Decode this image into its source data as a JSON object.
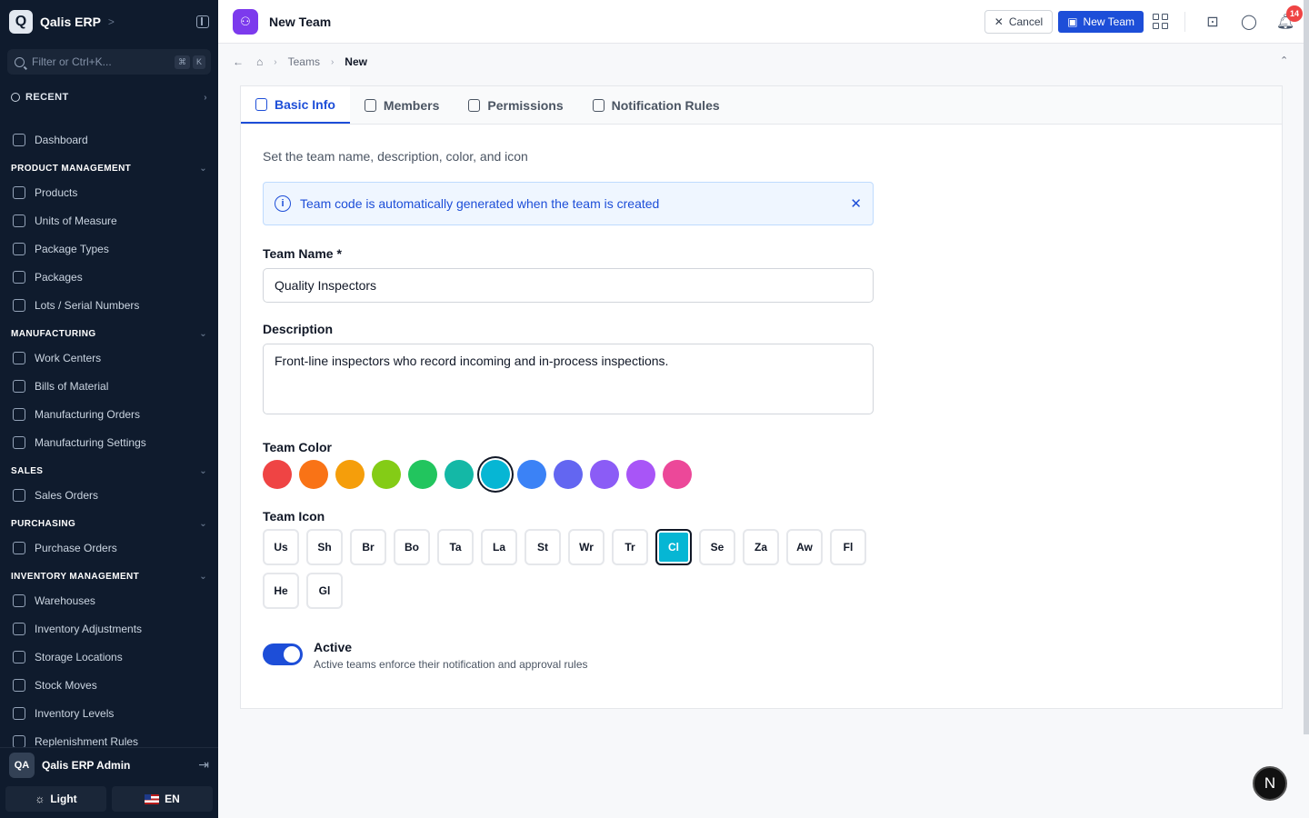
{
  "app": {
    "logo_letter": "Q",
    "name": "Qalis ERP"
  },
  "filter": {
    "placeholder": "Filter or Ctrl+K...",
    "keys": [
      "⌘",
      "K"
    ]
  },
  "recent": {
    "label": "RECENT"
  },
  "nav": {
    "dashboard": "Dashboard",
    "sections": [
      {
        "title": "PRODUCT MANAGEMENT",
        "items": [
          "Products",
          "Units of Measure",
          "Package Types",
          "Packages",
          "Lots / Serial Numbers"
        ]
      },
      {
        "title": "MANUFACTURING",
        "items": [
          "Work Centers",
          "Bills of Material",
          "Manufacturing Orders",
          "Manufacturing Settings"
        ]
      },
      {
        "title": "SALES",
        "items": [
          "Sales Orders"
        ]
      },
      {
        "title": "PURCHASING",
        "items": [
          "Purchase Orders"
        ]
      },
      {
        "title": "INVENTORY MANAGEMENT",
        "items": [
          "Warehouses",
          "Inventory Adjustments",
          "Storage Locations",
          "Stock Moves",
          "Inventory Levels",
          "Replenishment Rules"
        ]
      }
    ]
  },
  "user": {
    "initials": "QA",
    "name": "Qalis ERP Admin"
  },
  "footer": {
    "theme_label": "Light",
    "lang_label": "EN"
  },
  "topbar": {
    "title": "New Team",
    "cancel_label": "Cancel",
    "primary_label": "New Team",
    "notification_count": "14"
  },
  "breadcrumb": {
    "parent": "Teams",
    "current": "New"
  },
  "tabs": [
    {
      "label": "Basic Info",
      "icon": "document-icon",
      "active": true
    },
    {
      "label": "Members",
      "icon": "users-icon",
      "active": false
    },
    {
      "label": "Permissions",
      "icon": "shield-icon",
      "active": false
    },
    {
      "label": "Notification Rules",
      "icon": "bell-icon",
      "active": false
    }
  ],
  "form": {
    "description": "Set the team name, description, color, and icon",
    "alert": "Team code is automatically generated when the team is created",
    "name_label": "Team Name *",
    "name_value": "Quality Inspectors",
    "desc_label": "Description",
    "desc_value": "Front-line inspectors who record incoming and in-process inspections.",
    "color_label": "Team Color",
    "colors": [
      "#ef4444",
      "#f97316",
      "#f59e0b",
      "#84cc16",
      "#22c55e",
      "#14b8a6",
      "#06b6d4",
      "#3b82f6",
      "#6366f1",
      "#8b5cf6",
      "#a855f7",
      "#ec4899"
    ],
    "selected_color_index": 6,
    "icon_label": "Team Icon",
    "icons": [
      "Us",
      "Sh",
      "Br",
      "Bo",
      "Ta",
      "La",
      "St",
      "Wr",
      "Tr",
      "Cl",
      "Se",
      "Za",
      "Aw",
      "Fl",
      "He",
      "Gl"
    ],
    "selected_icon_index": 9,
    "active_label": "Active",
    "active_help": "Active teams enforce their notification and approval rules",
    "active": true
  },
  "fab_letter": "N"
}
